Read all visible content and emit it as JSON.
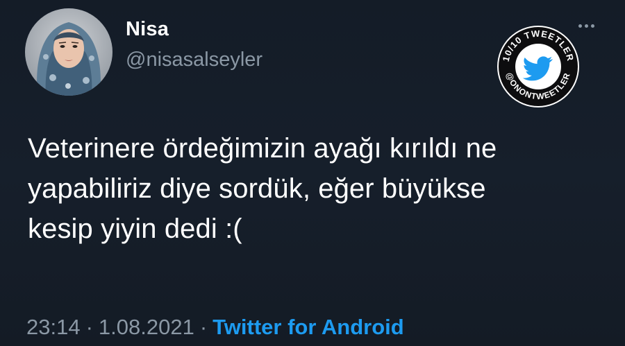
{
  "tweet": {
    "author": {
      "display_name": "Nisa",
      "handle": "@nisasalseyler",
      "avatar_icon": "profile-photo"
    },
    "text_lines": [
      "Veterinere ördeğimizin ayağı kırıldı ne",
      "yapabiliriz diye sordük, eğer büyükse",
      "kesip yiyin dedi :("
    ],
    "time": "23:14",
    "date": "1.08.2021",
    "separator": "·",
    "source": "Twitter for Android",
    "more_icon": "more-horizontal-icon"
  },
  "badge": {
    "top_text": "10/10 TWEETLER",
    "bottom_text": "@ONONTWEETLER",
    "icon": "twitter-bird-icon"
  },
  "colors": {
    "background": "#15202b",
    "text_primary": "#ffffff",
    "text_secondary": "#8b98a5",
    "accent": "#1d9bf0"
  }
}
